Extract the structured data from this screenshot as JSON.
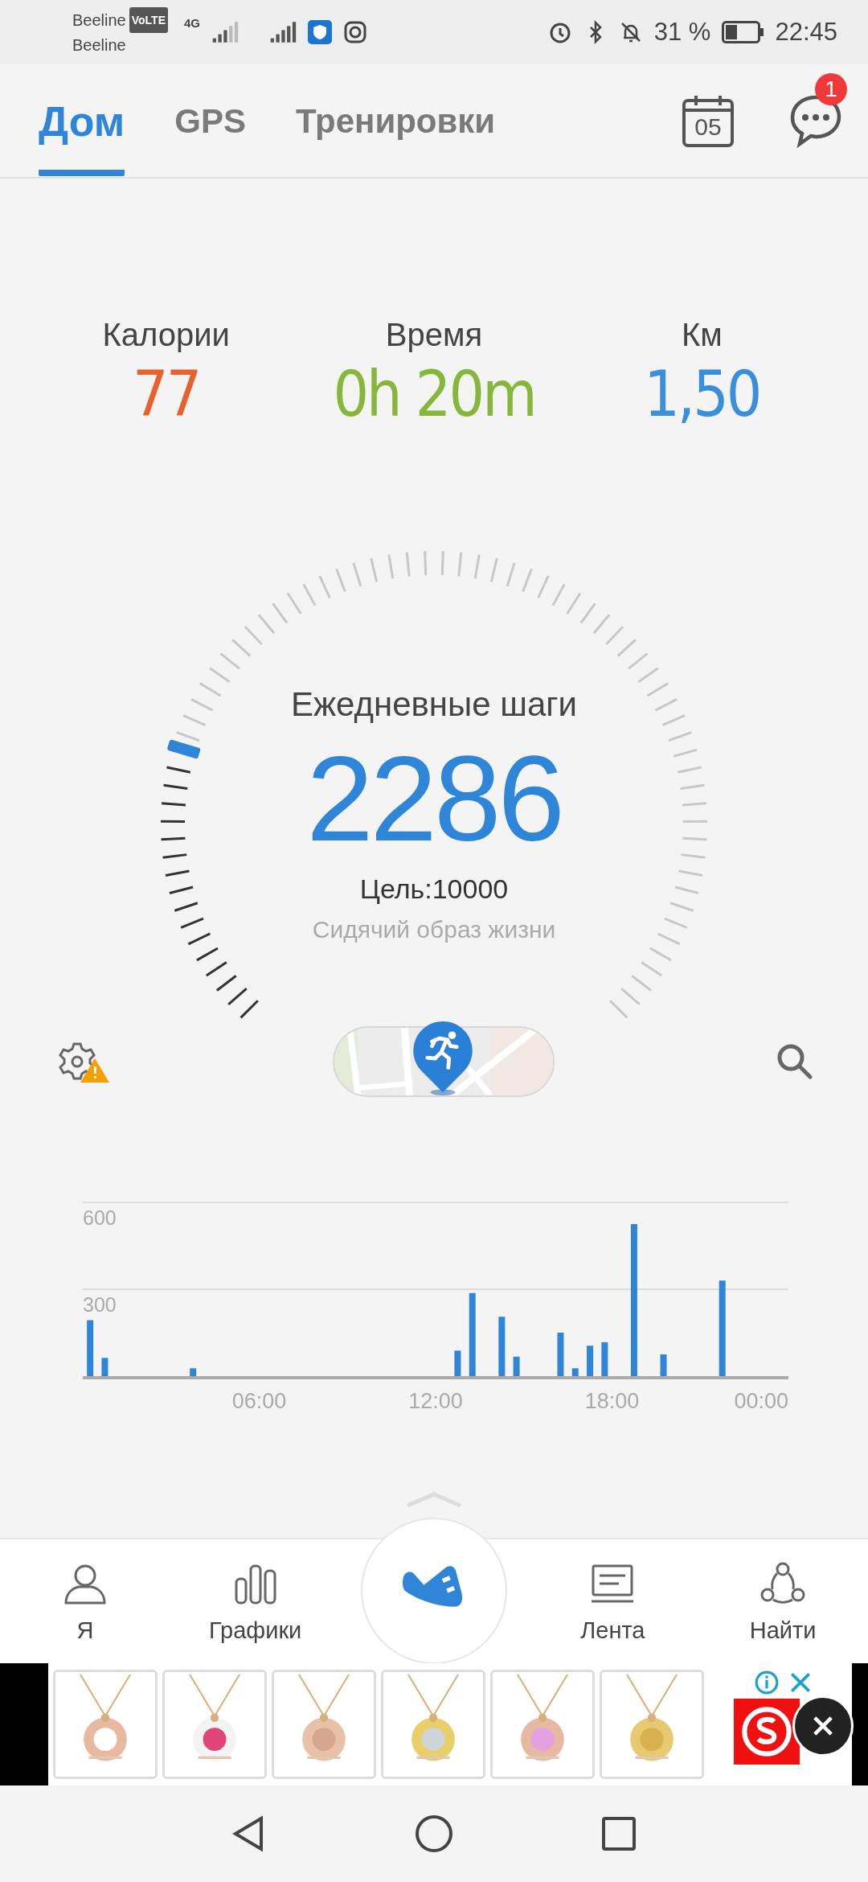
{
  "status_bar": {
    "carrier_1": "Beeline",
    "volte": "VoLTE",
    "network": "4G",
    "carrier_2": "Beeline",
    "battery": "31 %",
    "time": "22:45"
  },
  "tabs": [
    {
      "label": "Дом",
      "selected": true
    },
    {
      "label": "GPS",
      "selected": false
    },
    {
      "label": "Тренировки",
      "selected": false
    }
  ],
  "calendar_day": "05",
  "messages_badge": "1",
  "stats": [
    {
      "label": "Калории",
      "value": "77",
      "color": "#e8602c"
    },
    {
      "label": "Время",
      "value": "0h 20m",
      "color": "#86b63a"
    },
    {
      "label": "Км",
      "value": "1,50",
      "color": "#3a8fdc"
    }
  ],
  "steps": {
    "title": "Ежедневные шаги",
    "value": "2286",
    "goal": "Цель:10000",
    "activity": "Сидячий образ жизни"
  },
  "chart_data": {
    "type": "bar",
    "x": [
      0.25,
      0.75,
      3.75,
      12.75,
      13.25,
      14.25,
      14.75,
      16.25,
      16.75,
      17.25,
      17.75,
      18.75,
      19.75,
      21.75
    ],
    "values": [
      193,
      63,
      27,
      88,
      287,
      205,
      67,
      150,
      27,
      105,
      117,
      525,
      75,
      330
    ],
    "xlim": [
      0,
      24
    ],
    "ylim": [
      0,
      600
    ],
    "yticks": [
      300,
      600
    ],
    "xticks": [
      {
        "value": 6,
        "label": "06:00"
      },
      {
        "value": 12,
        "label": "12:00"
      },
      {
        "value": 18,
        "label": "18:00"
      },
      {
        "value": 24,
        "label": "00:00"
      }
    ]
  },
  "bottom_nav": [
    {
      "label": "Я",
      "kind": "person"
    },
    {
      "label": "Графики",
      "kind": "bars"
    },
    {
      "kind": "shoe"
    },
    {
      "label": "Лента",
      "kind": "feed"
    },
    {
      "label": "Найти",
      "kind": "share"
    }
  ]
}
